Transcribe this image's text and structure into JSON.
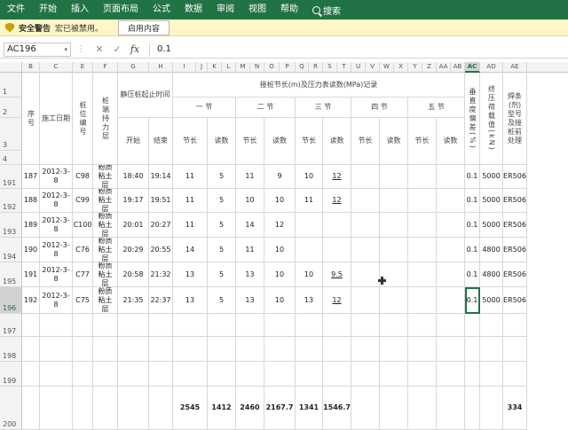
{
  "ribbon": {
    "tabs": [
      "文件",
      "开始",
      "插入",
      "页面布局",
      "公式",
      "数据",
      "审阅",
      "视图",
      "帮助"
    ],
    "search_icon": "search-icon",
    "search_label": "搜索"
  },
  "security": {
    "icon": "shield-icon",
    "title": "安全警告",
    "message": "宏已被禁用。",
    "button": "启用内容"
  },
  "formula_bar": {
    "name_box": "AC196",
    "dropdown": "▾",
    "cancel": "✕",
    "confirm": "✓",
    "fx": "fx",
    "value": "0.1"
  },
  "columns": [
    "B",
    "C",
    "E",
    "F",
    "G",
    "H",
    "I",
    "J",
    "K",
    "L",
    "M",
    "N",
    "O",
    "P",
    "Q",
    "R",
    "S",
    "T",
    "U",
    "V",
    "W",
    "X",
    "Y",
    "Z",
    "AA",
    "AB",
    "AC",
    "AD",
    "AE"
  ],
  "selected_column": "AC",
  "row_numbers": [
    "1",
    "2",
    "3",
    "4",
    "191",
    "192",
    "193",
    "194",
    "195",
    "196",
    "197",
    "198",
    "199",
    "200"
  ],
  "selected_row": "196",
  "headers": {
    "seq": "序号",
    "date": "施工日期",
    "pile_no": "桩位编号",
    "layer": "桩端持力层",
    "time_range": "静压桩起止时间",
    "start": "开始",
    "end": "结束",
    "section_record": "接桩节长(m)及压力表读数(MPa)记录",
    "sections": [
      "一 节",
      "二 节",
      "三 节",
      "四 节",
      "五 节"
    ],
    "length": "节长",
    "reading": "读数",
    "verticality": "垂直度偏差(%)",
    "final_pressure": "终压荷载值(kN)",
    "weld": "焊条(剂)型号及接桩前处理"
  },
  "rows": [
    {
      "seq": "187",
      "date": "2012-3-8",
      "pile": "C98",
      "layer": "粉质粘土层",
      "start": "18:40",
      "end": "19:14",
      "s1_len": "11",
      "s1_read": "5",
      "s2_len": "11",
      "s2_read": "9",
      "s3_len": "10",
      "s3_read": "12",
      "vert": "0.1",
      "load": "5000",
      "weld": "ER506"
    },
    {
      "seq": "188",
      "date": "2012-3-8",
      "pile": "C99",
      "layer": "粉质粘土层",
      "start": "19:17",
      "end": "19:51",
      "s1_len": "11",
      "s1_read": "5",
      "s2_len": "10",
      "s2_read": "10",
      "s3_len": "11",
      "s3_read": "12",
      "vert": "0.1",
      "load": "5000",
      "weld": "ER506"
    },
    {
      "seq": "189",
      "date": "2012-3-8",
      "pile": "C100",
      "layer": "粉质粘土层",
      "start": "20:01",
      "end": "20:27",
      "s1_len": "11",
      "s1_read": "5",
      "s2_len": "14",
      "s2_read": "12",
      "s3_len": "",
      "s3_read": "",
      "vert": "0.1",
      "load": "5000",
      "weld": "ER506"
    },
    {
      "seq": "190",
      "date": "2012-3-8",
      "pile": "C76",
      "layer": "粉质粘土层",
      "start": "20:29",
      "end": "20:55",
      "s1_len": "14",
      "s1_read": "5",
      "s2_len": "11",
      "s2_read": "10",
      "s3_len": "",
      "s3_read": "",
      "vert": "0.1",
      "load": "4800",
      "weld": "ER506"
    },
    {
      "seq": "191",
      "date": "2012-3-8",
      "pile": "C77",
      "layer": "粉质粘土层",
      "start": "20:58",
      "end": "21:32",
      "s1_len": "13",
      "s1_read": "5",
      "s2_len": "13",
      "s2_read": "10",
      "s3_len": "10",
      "s3_read": "9.5",
      "vert": "0.1",
      "load": "4800",
      "weld": "ER506"
    },
    {
      "seq": "192",
      "date": "2012-3-8",
      "pile": "C75",
      "layer": "粉质粘土层",
      "start": "21:35",
      "end": "22:37",
      "s1_len": "13",
      "s1_read": "5",
      "s2_len": "13",
      "s2_read": "10",
      "s3_len": "13",
      "s3_read": "12",
      "vert": "0.1",
      "load": "5000",
      "weld": "ER506"
    }
  ],
  "totals": {
    "s1_len": "2545",
    "s1_read": "1412",
    "s2_len": "2460",
    "s2_read": "2167.7",
    "s3_len": "1341",
    "s3_read": "1546.7",
    "weld": "334"
  },
  "cursor_icon": "crosshair-cursor-icon"
}
